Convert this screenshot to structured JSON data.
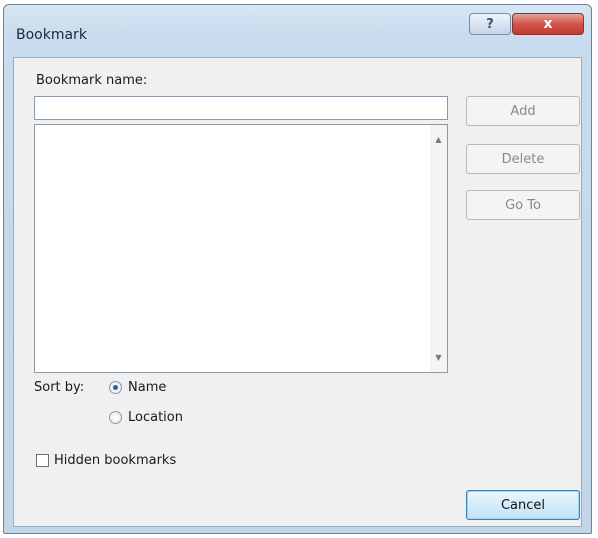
{
  "window": {
    "title": "Bookmark"
  },
  "titlebar": {
    "help_glyph": "?",
    "close_glyph": "x"
  },
  "form": {
    "name_label": "Bookmark name:",
    "name_value": "",
    "list_items": []
  },
  "buttons": {
    "add": "Add",
    "delete": "Delete",
    "goto": "Go To",
    "cancel": "Cancel"
  },
  "sort": {
    "label": "Sort by:",
    "options": [
      {
        "label": "Name",
        "selected": true
      },
      {
        "label": "Location",
        "selected": false
      }
    ]
  },
  "hidden": {
    "label": "Hidden bookmarks",
    "checked": false
  },
  "icons": {
    "scroll_up": "scroll-up-arrow-icon",
    "scroll_down": "scroll-down-arrow-icon"
  },
  "colors": {
    "close_button": "#c13b30",
    "titlebar": "#c9dbee",
    "client_bg": "#f0f0f0"
  }
}
